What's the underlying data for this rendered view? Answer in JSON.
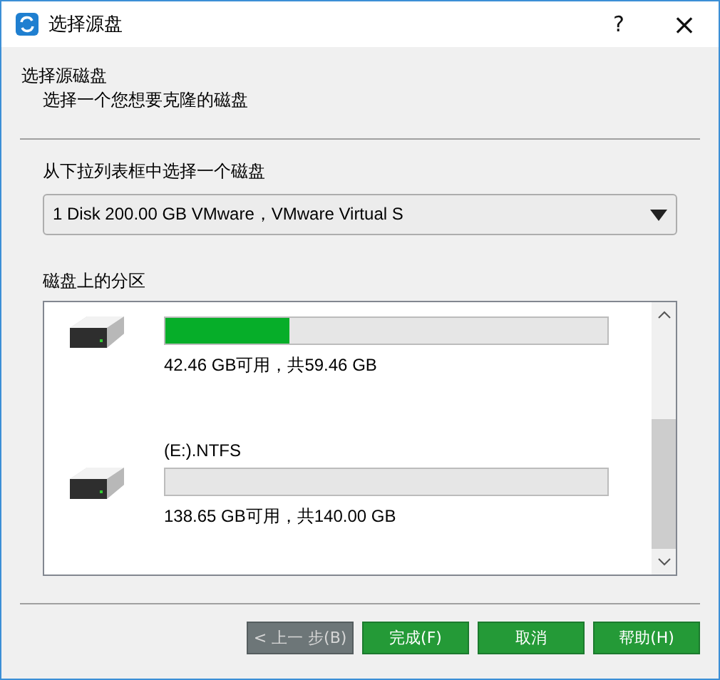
{
  "window": {
    "title": "选择源盘",
    "help": "?",
    "close": "×"
  },
  "header": {
    "title": "选择源磁盘",
    "subtitle": "选择一个您想要克隆的磁盘"
  },
  "disk_select": {
    "label": "从下拉列表框中选择一个磁盘",
    "value": "1 Disk 200.00 GB VMware，VMware Virtual S"
  },
  "partitions_label": "磁盘上的分区",
  "partitions": [
    {
      "level": 0.28,
      "usage": "42.46 GB可用，共59.46 GB"
    },
    {
      "name": "(E:).NTFS",
      "usage": "138.65 GB可用，共140.00 GB"
    }
  ],
  "buttons": [
    {
      "label": "< 上一 步(B)",
      "disabled": true
    },
    {
      "label": "完成(F)",
      "disabled": false
    },
    {
      "label": "取消",
      "disabled": false
    },
    {
      "label": "帮助(H)",
      "disabled": false
    }
  ]
}
